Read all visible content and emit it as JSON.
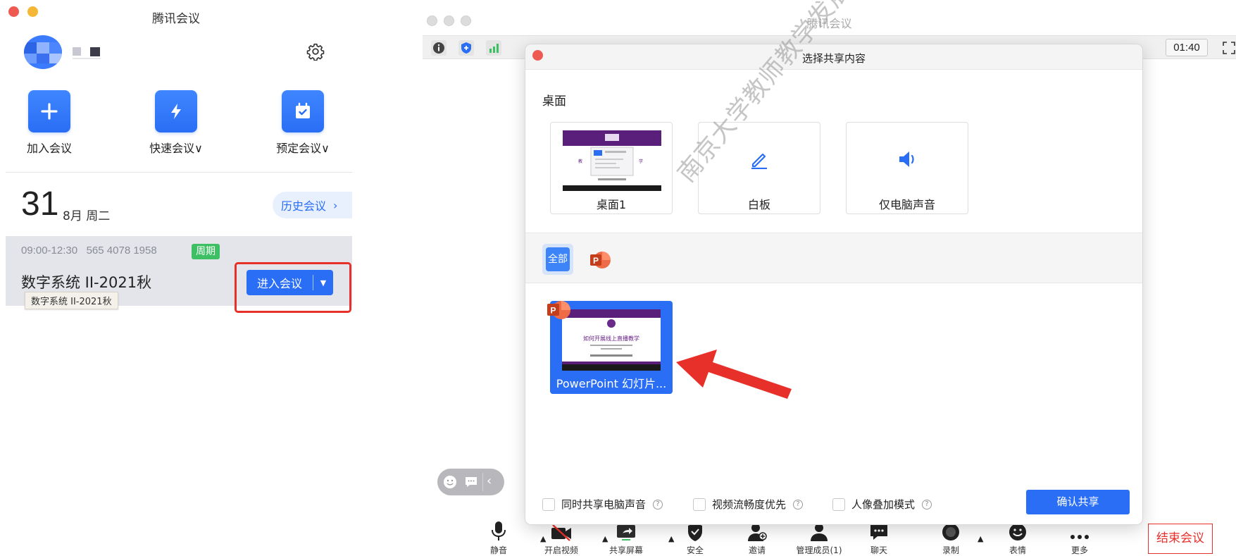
{
  "left_app": {
    "title": "腾讯会议",
    "actions": [
      {
        "label": "加入会议",
        "icon": "plus-icon"
      },
      {
        "label": "快速会议∨",
        "icon": "lightning-icon"
      },
      {
        "label": "预定会议∨",
        "icon": "calendar-check-icon"
      }
    ],
    "date": {
      "day": "31",
      "month_weekday": "8月 周二"
    },
    "history_button": "历史会议",
    "meeting": {
      "time": "09:00-12:30",
      "meeting_id": "565 4078 1958",
      "badge": "周期",
      "name": "数字系统 II-2021秋",
      "tooltip": "数字系统 II-2021秋",
      "join_button": "进入会议"
    }
  },
  "meeting_window": {
    "title": "腾讯会议",
    "timer": "01:40",
    "toolbar_icons": [
      "info-icon",
      "shield-icon",
      "signal-icon"
    ],
    "bottom_bar": [
      {
        "label": "静音",
        "icon": "microphone-icon"
      },
      {
        "label": "开启视频",
        "icon": "video-off-icon"
      },
      {
        "label": "共享屏幕",
        "icon": "share-screen-icon"
      },
      {
        "label": "安全",
        "icon": "security-icon"
      },
      {
        "label": "邀请",
        "icon": "invite-icon"
      },
      {
        "label": "管理成员(1)",
        "icon": "members-icon"
      },
      {
        "label": "聊天",
        "icon": "chat-icon"
      },
      {
        "label": "录制",
        "icon": "record-icon"
      },
      {
        "label": "表情",
        "icon": "emoji-icon"
      },
      {
        "label": "更多",
        "icon": "more-icon"
      }
    ],
    "end_button": "结束会议"
  },
  "share_dialog": {
    "title": "选择共享内容",
    "desktop_heading": "桌面",
    "desktop_options": [
      {
        "label": "桌面1",
        "icon": "desktop-thumbnail"
      },
      {
        "label": "白板",
        "icon": "pencil-icon"
      },
      {
        "label": "仅电脑声音",
        "icon": "speaker-icon"
      }
    ],
    "filter_all": "全部",
    "app_window": {
      "label": "PowerPoint 幻灯片...",
      "slide_title": "如何开展线上直播教学"
    },
    "options": [
      {
        "label": "同时共享电脑声音"
      },
      {
        "label": "视频流畅度优先"
      },
      {
        "label": "人像叠加模式"
      }
    ],
    "confirm_button": "确认共享"
  },
  "watermark": "南京大学教师教学发展中心版权所有",
  "colors": {
    "accent": "#2a6ef5",
    "annotation_red": "#e8302a",
    "success_green": "#3cc063"
  }
}
